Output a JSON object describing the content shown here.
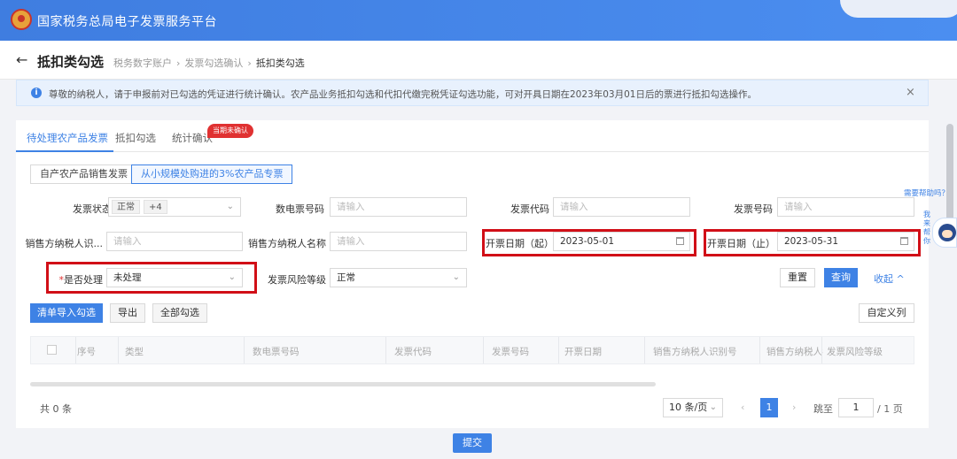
{
  "app": {
    "title": "国家税务总局电子发票服务平台"
  },
  "header": {
    "back_icon": "←",
    "page_title": "抵扣类勾选",
    "breadcrumb": [
      "税务数字账户",
      "发票勾选确认",
      "抵扣类勾选"
    ],
    "breadcrumb_sep": "›"
  },
  "notice": {
    "info_icon": "i",
    "text": "尊敬的纳税人，请于申报前对已勾选的凭证进行统计确认。农产品业务抵扣勾选和代扣代缴完税凭证勾选功能，可对开具日期在2023年03月01日后的票进行抵扣勾选操作。",
    "close_icon": "×"
  },
  "tabs": [
    {
      "label": "待处理农产品发票",
      "active": true
    },
    {
      "label": "抵扣勾选",
      "active": false
    },
    {
      "label": "统计确认",
      "active": false
    }
  ],
  "tab_badge": "当期未确认",
  "subtabs": [
    {
      "label": "自产农产品销售发票",
      "active": false
    },
    {
      "label": "从小规模处购进的3%农产品专票",
      "active": true
    }
  ],
  "filters": {
    "invoice_status": {
      "label": "发票状态",
      "tags": [
        "正常",
        "+4"
      ],
      "chevron": "⌄"
    },
    "e_invoice_no": {
      "label": "数电票号码",
      "placeholder": "请输入"
    },
    "invoice_code": {
      "label": "发票代码",
      "placeholder": "请输入"
    },
    "invoice_no": {
      "label": "发票号码",
      "placeholder": "请输入"
    },
    "seller_tax_id": {
      "label": "销售方纳税人识...",
      "placeholder": "请输入"
    },
    "seller_name": {
      "label": "销售方纳税人名称",
      "placeholder": "请输入"
    },
    "date_start": {
      "label": "开票日期（起）",
      "value": "2023-05-01"
    },
    "date_end": {
      "label": "开票日期（止）",
      "value": "2023-05-31"
    },
    "processed": {
      "required_mark": "*",
      "label": "是否处理",
      "value": "未处理",
      "chevron": "⌄"
    },
    "risk_level": {
      "label": "发票风险等级",
      "value": "正常",
      "chevron": "⌄"
    }
  },
  "actions": {
    "reset": "重置",
    "query": "查询",
    "collapse": "收起 ^",
    "import_check": "清单导入勾选",
    "export": "导出",
    "select_all": "全部勾选",
    "custom_columns": "自定义列"
  },
  "table": {
    "columns": [
      "序号",
      "类型",
      "数电票号码",
      "发票代码",
      "发票号码",
      "开票日期",
      "销售方纳税人识别号",
      "销售方纳税人名",
      "发票风险等级"
    ]
  },
  "pagination": {
    "total": "共 0 条",
    "page_size": "10 条/页",
    "chevron": "⌄",
    "prev": "‹",
    "current_page": "1",
    "next": "›",
    "jump_label": "跳至",
    "jump_value": "1",
    "page_count": "/ 1 页"
  },
  "submit": "提交",
  "help": {
    "text": "需要帮助吗？",
    "side_text": "我来帮你"
  }
}
